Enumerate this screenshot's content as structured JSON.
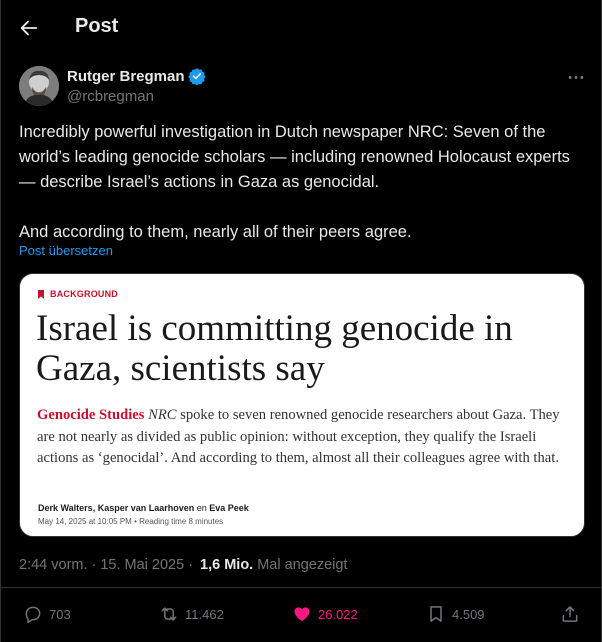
{
  "header": {
    "title": "Post"
  },
  "author": {
    "name": "Rutger Bregman",
    "handle": "@rcbregman"
  },
  "tweet": {
    "paragraph_1": "Incredibly powerful investigation in Dutch newspaper NRC: Seven of the world’s leading genocide scholars — including renowned Holocaust experts — describe Israel’s actions in Gaza as genocidal.",
    "paragraph_2": "And according to them, nearly all of their peers agree.",
    "translate_link": "Post übersetzen"
  },
  "card": {
    "kicker": "BACKGROUND",
    "headline": "Israel is committing genocide in Gaza, scientists say",
    "deck_label": "Genocide Studies",
    "deck_source": "NRC",
    "deck_text": "spoke to seven renowned genocide researchers about Gaza. They are not nearly as divided as public opinion: without exception, they qualify the Israeli actions as ‘genocidal’. And according to them, almost all their colleagues agree with that.",
    "authors": "Derk Walters, Kasper van Laarhoven",
    "authors_joiner": "en",
    "author_last": "Eva Peek",
    "date": "May 14, 2025 at 10:05 PM",
    "reading_time": "Reading time 8 minutes",
    "meta_separator": "•"
  },
  "meta": {
    "time": "2:44 vorm.",
    "separator": "·",
    "date": "15. Mai 2025",
    "views": "1,6 Mio.",
    "views_label": "Mal angezeigt"
  },
  "actions": {
    "replies": "703",
    "reposts": "11.462",
    "likes": "26.022",
    "bookmarks": "4.509"
  },
  "colors": {
    "background": "#000000",
    "text": "#e7e9ea",
    "muted": "#71767b",
    "accent": "#1d9bf0",
    "like": "#f91880",
    "card_red": "#c8102e"
  },
  "icons": {
    "back": "arrow-left-icon",
    "verified": "verified-badge-icon",
    "more": "more-dots-icon",
    "reply": "reply-icon",
    "repost": "repost-icon",
    "like": "heart-icon",
    "bookmark": "bookmark-icon",
    "share": "share-icon"
  }
}
